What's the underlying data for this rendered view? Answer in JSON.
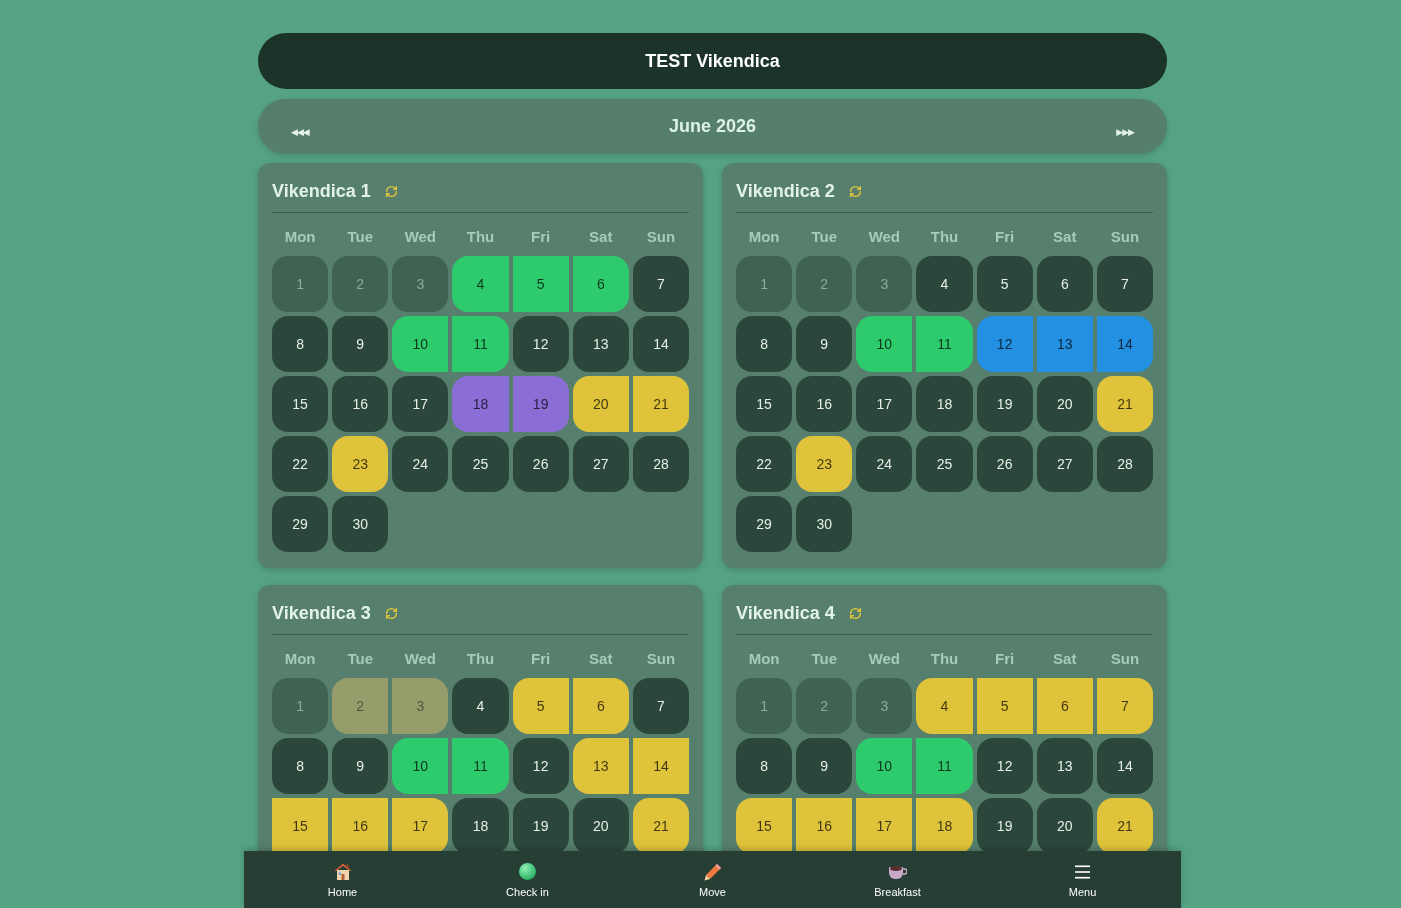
{
  "header": {
    "title": "TEST Vikendica"
  },
  "month_nav": {
    "prev": "◀◀◀",
    "label": "June 2026",
    "next": "▶▶▶"
  },
  "calendars": [
    {
      "title": "Vikendica 1",
      "weekdays": [
        "Mon",
        "Tue",
        "Wed",
        "Thu",
        "Fri",
        "Sat",
        "Sun"
      ],
      "days": [
        {
          "label": "1",
          "kind": "open",
          "past": true
        },
        {
          "label": "2",
          "kind": "open",
          "past": true
        },
        {
          "label": "3",
          "kind": "open",
          "past": true
        },
        {
          "label": "4",
          "kind": "booked",
          "past": false,
          "color": "#2ecb6c",
          "start": true,
          "end": false
        },
        {
          "label": "5",
          "kind": "booked",
          "past": false,
          "color": "#2ecb6c",
          "start": false,
          "end": false
        },
        {
          "label": "6",
          "kind": "booked",
          "past": false,
          "color": "#2ecb6c",
          "start": false,
          "end": true
        },
        {
          "label": "7",
          "kind": "open",
          "past": false
        },
        {
          "label": "8",
          "kind": "open",
          "past": false
        },
        {
          "label": "9",
          "kind": "open",
          "past": false
        },
        {
          "label": "10",
          "kind": "booked",
          "past": false,
          "color": "#2ecb6c",
          "start": true,
          "end": false
        },
        {
          "label": "11",
          "kind": "booked",
          "past": false,
          "color": "#2ecb6c",
          "start": false,
          "end": true
        },
        {
          "label": "12",
          "kind": "open",
          "past": false
        },
        {
          "label": "13",
          "kind": "open",
          "past": false
        },
        {
          "label": "14",
          "kind": "open",
          "past": false
        },
        {
          "label": "15",
          "kind": "open",
          "past": false
        },
        {
          "label": "16",
          "kind": "open",
          "past": false
        },
        {
          "label": "17",
          "kind": "open",
          "past": false
        },
        {
          "label": "18",
          "kind": "booked",
          "past": false,
          "color": "#8a6dd5",
          "start": true,
          "end": false
        },
        {
          "label": "19",
          "kind": "booked",
          "past": false,
          "color": "#8a6dd5",
          "start": false,
          "end": true
        },
        {
          "label": "20",
          "kind": "booked",
          "past": false,
          "color": "#dfc33a",
          "start": true,
          "end": false
        },
        {
          "label": "21",
          "kind": "booked",
          "past": false,
          "color": "#dfc33a",
          "start": false,
          "end": true
        },
        {
          "label": "22",
          "kind": "open",
          "past": false
        },
        {
          "label": "23",
          "kind": "booked",
          "past": false,
          "color": "#dfc33a",
          "start": true,
          "end": true
        },
        {
          "label": "24",
          "kind": "open",
          "past": false
        },
        {
          "label": "25",
          "kind": "open",
          "past": false
        },
        {
          "label": "26",
          "kind": "open",
          "past": false
        },
        {
          "label": "27",
          "kind": "open",
          "past": false
        },
        {
          "label": "28",
          "kind": "open",
          "past": false
        },
        {
          "label": "29",
          "kind": "open",
          "past": false
        },
        {
          "label": "30",
          "kind": "open",
          "past": false
        }
      ]
    },
    {
      "title": "Vikendica 2",
      "weekdays": [
        "Mon",
        "Tue",
        "Wed",
        "Thu",
        "Fri",
        "Sat",
        "Sun"
      ],
      "days": [
        {
          "label": "1",
          "kind": "open",
          "past": true
        },
        {
          "label": "2",
          "kind": "open",
          "past": true
        },
        {
          "label": "3",
          "kind": "open",
          "past": true
        },
        {
          "label": "4",
          "kind": "open",
          "past": false
        },
        {
          "label": "5",
          "kind": "open",
          "past": false
        },
        {
          "label": "6",
          "kind": "open",
          "past": false
        },
        {
          "label": "7",
          "kind": "open",
          "past": false
        },
        {
          "label": "8",
          "kind": "open",
          "past": false
        },
        {
          "label": "9",
          "kind": "open",
          "past": false
        },
        {
          "label": "10",
          "kind": "booked",
          "past": false,
          "color": "#2ecb6c",
          "start": true,
          "end": false
        },
        {
          "label": "11",
          "kind": "booked",
          "past": false,
          "color": "#2ecb6c",
          "start": false,
          "end": true
        },
        {
          "label": "12",
          "kind": "booked",
          "past": false,
          "color": "#2490e2",
          "start": true,
          "end": false
        },
        {
          "label": "13",
          "kind": "booked",
          "past": false,
          "color": "#2490e2",
          "start": false,
          "end": false
        },
        {
          "label": "14",
          "kind": "booked",
          "past": false,
          "color": "#2490e2",
          "start": false,
          "end": true
        },
        {
          "label": "15",
          "kind": "open",
          "past": false
        },
        {
          "label": "16",
          "kind": "open",
          "past": false
        },
        {
          "label": "17",
          "kind": "open",
          "past": false
        },
        {
          "label": "18",
          "kind": "open",
          "past": false
        },
        {
          "label": "19",
          "kind": "open",
          "past": false
        },
        {
          "label": "20",
          "kind": "open",
          "past": false
        },
        {
          "label": "21",
          "kind": "booked",
          "past": false,
          "color": "#dfc33a",
          "start": true,
          "end": true
        },
        {
          "label": "22",
          "kind": "open",
          "past": false
        },
        {
          "label": "23",
          "kind": "booked",
          "past": false,
          "color": "#dfc33a",
          "start": true,
          "end": true
        },
        {
          "label": "24",
          "kind": "open",
          "past": false
        },
        {
          "label": "25",
          "kind": "open",
          "past": false
        },
        {
          "label": "26",
          "kind": "open",
          "past": false
        },
        {
          "label": "27",
          "kind": "open",
          "past": false
        },
        {
          "label": "28",
          "kind": "open",
          "past": false
        },
        {
          "label": "29",
          "kind": "open",
          "past": false
        },
        {
          "label": "30",
          "kind": "open",
          "past": false
        }
      ]
    },
    {
      "title": "Vikendica 3",
      "weekdays": [
        "Mon",
        "Tue",
        "Wed",
        "Thu",
        "Fri",
        "Sat",
        "Sun"
      ],
      "days": [
        {
          "label": "1",
          "kind": "open",
          "past": true
        },
        {
          "label": "2",
          "kind": "booked",
          "past": true,
          "color": "#979d6a",
          "start": true,
          "end": false
        },
        {
          "label": "3",
          "kind": "booked",
          "past": true,
          "color": "#979d6a",
          "start": false,
          "end": true
        },
        {
          "label": "4",
          "kind": "open",
          "past": false
        },
        {
          "label": "5",
          "kind": "booked",
          "past": false,
          "color": "#dfc33a",
          "start": true,
          "end": false
        },
        {
          "label": "6",
          "kind": "booked",
          "past": false,
          "color": "#dfc33a",
          "start": false,
          "end": true
        },
        {
          "label": "7",
          "kind": "open",
          "past": false
        },
        {
          "label": "8",
          "kind": "open",
          "past": false
        },
        {
          "label": "9",
          "kind": "open",
          "past": false
        },
        {
          "label": "10",
          "kind": "booked",
          "past": false,
          "color": "#2ecb6c",
          "start": true,
          "end": false
        },
        {
          "label": "11",
          "kind": "booked",
          "past": false,
          "color": "#2ecb6c",
          "start": false,
          "end": true
        },
        {
          "label": "12",
          "kind": "open",
          "past": false
        },
        {
          "label": "13",
          "kind": "booked",
          "past": false,
          "color": "#dfc33a",
          "start": true,
          "end": false
        },
        {
          "label": "14",
          "kind": "booked",
          "past": false,
          "color": "#dfc33a",
          "start": false,
          "end": false
        },
        {
          "label": "15",
          "kind": "booked",
          "past": false,
          "color": "#dfc33a",
          "start": false,
          "end": false
        },
        {
          "label": "16",
          "kind": "booked",
          "past": false,
          "color": "#dfc33a",
          "start": false,
          "end": false
        },
        {
          "label": "17",
          "kind": "booked",
          "past": false,
          "color": "#dfc33a",
          "start": false,
          "end": true
        },
        {
          "label": "18",
          "kind": "open",
          "past": false
        },
        {
          "label": "19",
          "kind": "open",
          "past": false
        },
        {
          "label": "20",
          "kind": "open",
          "past": false
        },
        {
          "label": "21",
          "kind": "booked",
          "past": false,
          "color": "#dfc33a",
          "start": true,
          "end": true
        }
      ]
    },
    {
      "title": "Vikendica 4",
      "weekdays": [
        "Mon",
        "Tue",
        "Wed",
        "Thu",
        "Fri",
        "Sat",
        "Sun"
      ],
      "days": [
        {
          "label": "1",
          "kind": "open",
          "past": true
        },
        {
          "label": "2",
          "kind": "open",
          "past": true
        },
        {
          "label": "3",
          "kind": "open",
          "past": true
        },
        {
          "label": "4",
          "kind": "booked",
          "past": false,
          "color": "#dfc33a",
          "start": true,
          "end": false
        },
        {
          "label": "5",
          "kind": "booked",
          "past": false,
          "color": "#dfc33a",
          "start": false,
          "end": false
        },
        {
          "label": "6",
          "kind": "booked",
          "past": false,
          "color": "#dfc33a",
          "start": false,
          "end": false
        },
        {
          "label": "7",
          "kind": "booked",
          "past": false,
          "color": "#dfc33a",
          "start": false,
          "end": true
        },
        {
          "label": "8",
          "kind": "open",
          "past": false
        },
        {
          "label": "9",
          "kind": "open",
          "past": false
        },
        {
          "label": "10",
          "kind": "booked",
          "past": false,
          "color": "#2ecb6c",
          "start": true,
          "end": false
        },
        {
          "label": "11",
          "kind": "booked",
          "past": false,
          "color": "#2ecb6c",
          "start": false,
          "end": true
        },
        {
          "label": "12",
          "kind": "open",
          "past": false
        },
        {
          "label": "13",
          "kind": "open",
          "past": false
        },
        {
          "label": "14",
          "kind": "open",
          "past": false
        },
        {
          "label": "15",
          "kind": "booked",
          "past": false,
          "color": "#dfc33a",
          "start": true,
          "end": false
        },
        {
          "label": "16",
          "kind": "booked",
          "past": false,
          "color": "#dfc33a",
          "start": false,
          "end": false
        },
        {
          "label": "17",
          "kind": "booked",
          "past": false,
          "color": "#dfc33a",
          "start": false,
          "end": false
        },
        {
          "label": "18",
          "kind": "booked",
          "past": false,
          "color": "#dfc33a",
          "start": false,
          "end": true
        },
        {
          "label": "19",
          "kind": "open",
          "past": false
        },
        {
          "label": "20",
          "kind": "open",
          "past": false
        },
        {
          "label": "21",
          "kind": "booked",
          "past": false,
          "color": "#dfc33a",
          "start": true,
          "end": true
        }
      ]
    }
  ],
  "bottom_nav": [
    {
      "label": "Home"
    },
    {
      "label": "Check in"
    },
    {
      "label": "Move"
    },
    {
      "label": "Breakfast"
    },
    {
      "label": "Menu"
    }
  ]
}
